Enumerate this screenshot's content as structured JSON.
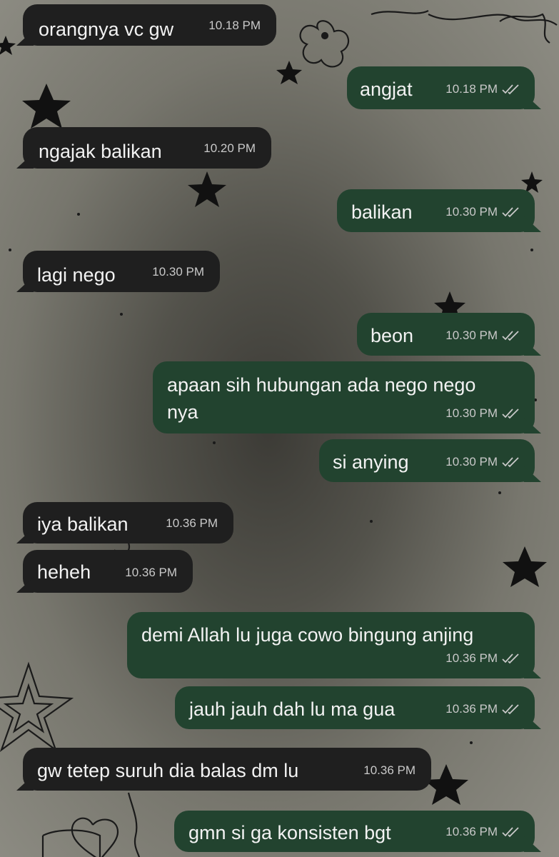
{
  "conversation": {
    "messages": [
      {
        "direction": "in",
        "text": "orangnya vc gw",
        "time": "10.18 PM"
      },
      {
        "direction": "out",
        "text": "angjat",
        "time": "10.18 PM",
        "status": "double-check-icon"
      },
      {
        "direction": "in",
        "text": "ngajak balikan",
        "time": "10.20 PM"
      },
      {
        "direction": "out",
        "text": "balikan",
        "time": "10.30 PM",
        "status": "double-check-icon"
      },
      {
        "direction": "in",
        "text": "lagi nego",
        "time": "10.30 PM"
      },
      {
        "direction": "out",
        "text": "beon",
        "time": "10.30 PM",
        "status": "double-check-icon"
      },
      {
        "direction": "out",
        "text": "apaan sih hubungan ada nego nego",
        "text2": "nya",
        "time": "10.30 PM",
        "status": "double-check-icon"
      },
      {
        "direction": "out",
        "text": "si anying",
        "time": "10.30 PM",
        "status": "double-check-icon"
      },
      {
        "direction": "in",
        "text": "iya balikan",
        "time": "10.36 PM"
      },
      {
        "direction": "in",
        "text": "heheh",
        "time": "10.36 PM"
      },
      {
        "direction": "out",
        "text": "demi Allah lu juga cowo bingung anjing",
        "time": "10.36 PM",
        "status": "double-check-icon"
      },
      {
        "direction": "out",
        "text": "jauh jauh dah lu ma gua",
        "time": "10.36 PM",
        "status": "double-check-icon"
      },
      {
        "direction": "in",
        "text": "gw tetep suruh dia balas dm lu",
        "time": "10.36 PM"
      },
      {
        "direction": "out",
        "text": "gmn si ga konsisten bgt",
        "time": "10.36 PM",
        "status": "double-check-icon"
      }
    ]
  },
  "colors": {
    "incoming_bubble": "#1f1f1f",
    "outgoing_bubble": "#22432f",
    "text": "#f2f2f2",
    "meta": "#c9c9c9"
  }
}
